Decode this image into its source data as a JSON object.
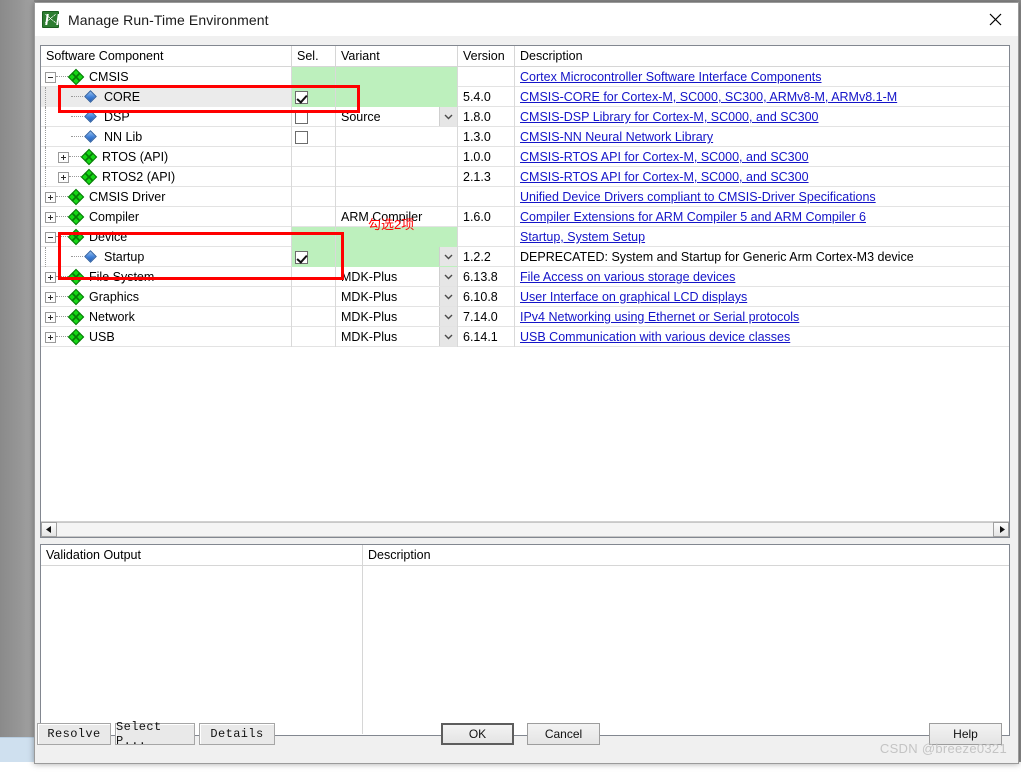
{
  "window": {
    "title": "Manage Run-Time Environment",
    "app_icon": "keil-uvision-icon",
    "close_icon": "close-icon"
  },
  "tree": {
    "columns": [
      {
        "key": "name",
        "label": "Software Component"
      },
      {
        "key": "sel",
        "label": "Sel."
      },
      {
        "key": "variant",
        "label": "Variant"
      },
      {
        "key": "version",
        "label": "Version"
      },
      {
        "key": "desc",
        "label": "Description"
      }
    ],
    "rows": [
      {
        "name": "CMSIS",
        "level": 0,
        "kind": "group",
        "expander": "minus",
        "sel_kind": "green",
        "checked": false,
        "variant": "",
        "variant_combo": false,
        "version": "",
        "desc": "Cortex Microcontroller Software Interface Components",
        "desc_link": true,
        "selected": false
      },
      {
        "name": "CORE",
        "level": 1,
        "kind": "leaf",
        "expander": "none",
        "sel_kind": "checkbox-green",
        "checked": true,
        "variant": "",
        "variant_combo": false,
        "version": "5.4.0",
        "desc": "CMSIS-CORE for Cortex-M, SC000, SC300, ARMv8-M, ARMv8.1-M",
        "desc_link": true,
        "selected": true
      },
      {
        "name": "DSP",
        "level": 1,
        "kind": "leaf",
        "expander": "none",
        "sel_kind": "checkbox",
        "checked": false,
        "variant": "Source",
        "variant_combo": true,
        "version": "1.8.0",
        "desc": "CMSIS-DSP Library for Cortex-M, SC000, and SC300",
        "desc_link": true,
        "selected": false
      },
      {
        "name": "NN Lib",
        "level": 1,
        "kind": "leaf",
        "expander": "none",
        "sel_kind": "checkbox",
        "checked": false,
        "variant": "",
        "variant_combo": false,
        "version": "1.3.0",
        "desc": "CMSIS-NN Neural Network Library",
        "desc_link": true,
        "selected": false
      },
      {
        "name": "RTOS (API)",
        "level": 1,
        "kind": "group",
        "expander": "plus",
        "sel_kind": "none",
        "checked": false,
        "variant": "",
        "variant_combo": false,
        "version": "1.0.0",
        "desc": "CMSIS-RTOS API for Cortex-M, SC000, and SC300",
        "desc_link": true,
        "selected": false
      },
      {
        "name": "RTOS2 (API)",
        "level": 1,
        "kind": "group",
        "expander": "plus",
        "sel_kind": "none",
        "checked": false,
        "variant": "",
        "variant_combo": false,
        "version": "2.1.3",
        "desc": "CMSIS-RTOS API for Cortex-M, SC000, and SC300",
        "desc_link": true,
        "selected": false
      },
      {
        "name": "CMSIS Driver",
        "level": 0,
        "kind": "group",
        "expander": "plus",
        "sel_kind": "none",
        "checked": false,
        "variant": "",
        "variant_combo": false,
        "version": "",
        "desc": "Unified Device Drivers compliant to CMSIS-Driver Specifications",
        "desc_link": true,
        "selected": false
      },
      {
        "name": "Compiler",
        "level": 0,
        "kind": "group",
        "expander": "plus",
        "sel_kind": "none",
        "checked": false,
        "variant": "ARM Compiler",
        "variant_combo": false,
        "version": "1.6.0",
        "desc": "Compiler Extensions for ARM Compiler 5 and ARM Compiler 6",
        "desc_link": true,
        "selected": false
      },
      {
        "name": "Device",
        "level": 0,
        "kind": "group",
        "expander": "minus",
        "sel_kind": "green",
        "checked": false,
        "variant": "",
        "variant_combo": false,
        "version": "",
        "desc": "Startup, System Setup",
        "desc_link": true,
        "selected": false
      },
      {
        "name": "Startup",
        "level": 1,
        "kind": "leaf",
        "expander": "none",
        "sel_kind": "checkbox-green",
        "checked": true,
        "variant": "",
        "variant_combo": true,
        "version": "1.2.2",
        "desc": "DEPRECATED: System and Startup for Generic Arm Cortex-M3 device",
        "desc_link": false,
        "selected": false
      },
      {
        "name": "File System",
        "level": 0,
        "kind": "group",
        "expander": "plus",
        "sel_kind": "none",
        "checked": false,
        "variant": "MDK-Plus",
        "variant_combo": true,
        "version": "6.13.8",
        "desc": "File Access on various storage devices",
        "desc_link": true,
        "selected": false
      },
      {
        "name": "Graphics",
        "level": 0,
        "kind": "group",
        "expander": "plus",
        "sel_kind": "none",
        "checked": false,
        "variant": "MDK-Plus",
        "variant_combo": true,
        "version": "6.10.8",
        "desc": "User Interface on graphical LCD displays",
        "desc_link": true,
        "selected": false
      },
      {
        "name": "Network",
        "level": 0,
        "kind": "group",
        "expander": "plus",
        "sel_kind": "none",
        "checked": false,
        "variant": "MDK-Plus",
        "variant_combo": true,
        "version": "7.14.0",
        "desc": "IPv4 Networking using Ethernet or Serial protocols",
        "desc_link": true,
        "selected": false
      },
      {
        "name": "USB",
        "level": 0,
        "kind": "group",
        "expander": "plus",
        "sel_kind": "none",
        "checked": false,
        "variant": "MDK-Plus",
        "variant_combo": true,
        "version": "6.14.1",
        "desc": "USB Communication with various device classes",
        "desc_link": true,
        "selected": false
      }
    ],
    "scrollbar": {
      "left_arrow_icon": "arrow-left-icon",
      "right_arrow_icon": "arrow-right-icon"
    }
  },
  "validation": {
    "col_output": "Validation Output",
    "col_description": "Description",
    "rows": []
  },
  "footer": {
    "resolve": "Resolve",
    "select_packs": "Select P...",
    "details": "Details",
    "ok": "OK",
    "cancel": "Cancel",
    "help": "Help"
  },
  "annotations": {
    "note_text": "勾选2项",
    "color": "#ff0000"
  },
  "watermark": "CSDN @breeze0321"
}
